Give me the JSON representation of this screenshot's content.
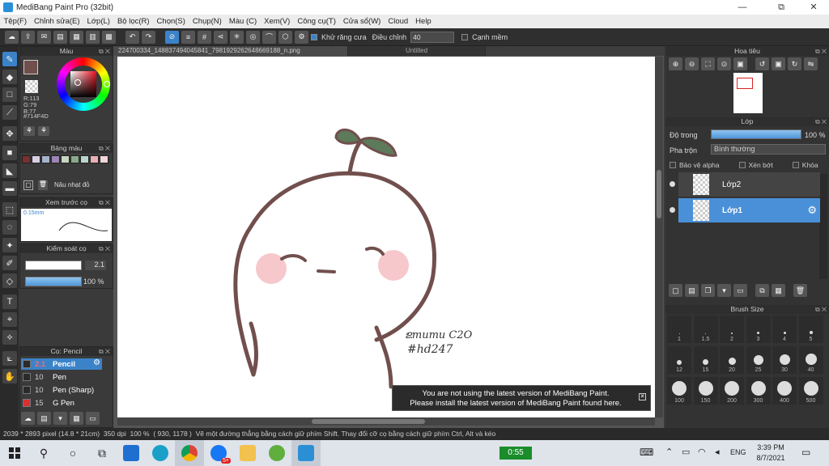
{
  "window": {
    "title": "MediBang Paint Pro (32bit)",
    "minimize": "—",
    "restore": "⧉",
    "close": "✕"
  },
  "menu": [
    "Tệp(F)",
    "Chỉnh sửa(E)",
    "Lớp(L)",
    "Bộ lọc(R)",
    "Chọn(S)",
    "Chụp(N)",
    "Màu (C)",
    "Xem(V)",
    "Công cụ(T)",
    "Cửa sổ(W)",
    "Cloud",
    "Help"
  ],
  "toolbar": {
    "antialias": "Khử răng cưa",
    "adjust": "Điều chỉnh",
    "adjust_value": "40",
    "snap": "Cạnh mềm"
  },
  "color_panel": {
    "title": "Màu",
    "r": "R:113",
    "g": "G:79",
    "b": "B:77",
    "hex": "#714F4D",
    "fg": "#714f4d"
  },
  "palette_panel": {
    "title": "Bảng màu",
    "swatches": [
      "#7a3030",
      "#d8cfe6",
      "#a6b3cc",
      "#9b86b8",
      "#c6d6c2",
      "#8aa88a",
      "#b9d7cf",
      "#e9b1b6",
      "#f2d6da"
    ],
    "item_label": "Nâu nhạt đỏ"
  },
  "brush_preview": {
    "title": "Xem trước cọ",
    "size": "0.15mm"
  },
  "brush_control": {
    "title": "Kiểm soát cọ",
    "size": "2.1",
    "opacity": "100 %"
  },
  "brush_list": {
    "title": "Cọ: Pencil",
    "items": [
      {
        "size": "2.1",
        "name": "Pencil",
        "color": "#2a2a2a",
        "selected": true
      },
      {
        "size": "10",
        "name": "Pen",
        "color": "#2a2a2a",
        "selected": false
      },
      {
        "size": "10",
        "name": "Pen (Sharp)",
        "color": "#2a2a2a",
        "selected": false
      },
      {
        "size": "15",
        "name": "G Pen",
        "color": "#d93030",
        "selected": false
      }
    ]
  },
  "tabs": {
    "file": "224700334_148837494045841_7981929262648669188_n.png",
    "untitled": "Untitled"
  },
  "artwork": {
    "signature_line1": "ຂmumu C2O",
    "signature_line2": "#hd247"
  },
  "notice": {
    "line1": "You are not using the latest version of MediBang Paint.",
    "line2": "Please install the latest version of MediBang Paint found here."
  },
  "navigator": {
    "title": "Hoa tiêu"
  },
  "layer_panel": {
    "title": "Lớp",
    "opacity_label": "Độ trong",
    "opacity_value": "100 %",
    "opacity": 1.0,
    "blend_label": "Pha trộn",
    "blend_value": "Bình thường",
    "alpha_lock": "Bảo vệ alpha",
    "clip": "Xén bớt",
    "lock": "Khóa",
    "layers": [
      {
        "name": "Lớp2",
        "selected": false
      },
      {
        "name": "Lớp1",
        "selected": true
      }
    ]
  },
  "brush_size": {
    "title": "Brush Size",
    "sizes": [
      "1",
      "1.5",
      "2",
      "3",
      "4",
      "5",
      "12",
      "15",
      "20",
      "25",
      "30",
      "40",
      "100",
      "150",
      "200",
      "300",
      "400",
      "500"
    ]
  },
  "status": {
    "dimensions": "2039 * 2893 pixel",
    "physical": "(14.8 * 21cm)",
    "dpi": "350 dpi",
    "zoom": "100 %",
    "coords": "( 930, 1178 )",
    "hint": "Vẽ một đường thẳng bằng cách giữ phím Shift. Thay đổi cỡ cọ bằng cách giữ phím Ctrl, Alt và kéo"
  },
  "taskbar": {
    "timer": "0:55",
    "lang": "ENG",
    "time": "3:39 PM",
    "date": "8/7/2021",
    "badge": "5+"
  }
}
